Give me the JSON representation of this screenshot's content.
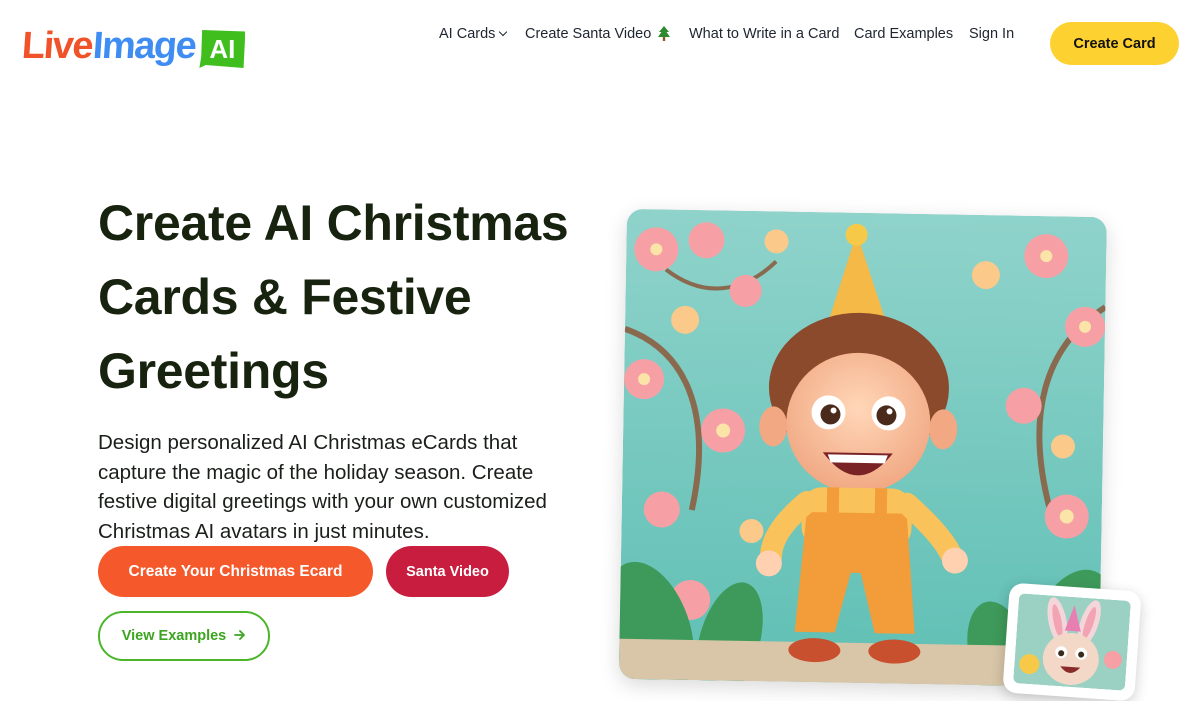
{
  "brand": {
    "logo_part1": "Live",
    "logo_part2": "Image",
    "logo_badge": "AI",
    "colors": {
      "live": "#f0532a",
      "image": "#3f8df2",
      "badge": "#3fbe1e"
    }
  },
  "nav": {
    "ai_cards": "AI Cards",
    "santa_video": "Create Santa Video",
    "write_card": "What to Write in a Card",
    "examples": "Card Examples",
    "sign_in": "Sign In",
    "create_card": "Create Card"
  },
  "hero": {
    "title": "Create AI Christmas Cards & Festive Greetings",
    "description": "Design personalized AI Christmas eCards that capture the magic of the holiday season. Create festive digital greetings with your own customized Christmas AI avatars in just minutes.",
    "primary_cta": "Create Your Christmas Ecard",
    "santa_cta": "Santa Video",
    "examples_cta": "View Examples"
  },
  "icons": {
    "ai_cards_dropdown": "chevron-down-icon",
    "santa_video": "christmas-tree-icon",
    "examples_cta": "arrow-right-icon"
  },
  "colors": {
    "accent_yellow": "#fdd12f",
    "accent_orange": "#f5582a",
    "accent_red": "#c81d3e",
    "accent_green": "#4cb62a",
    "heading": "#17220f"
  }
}
